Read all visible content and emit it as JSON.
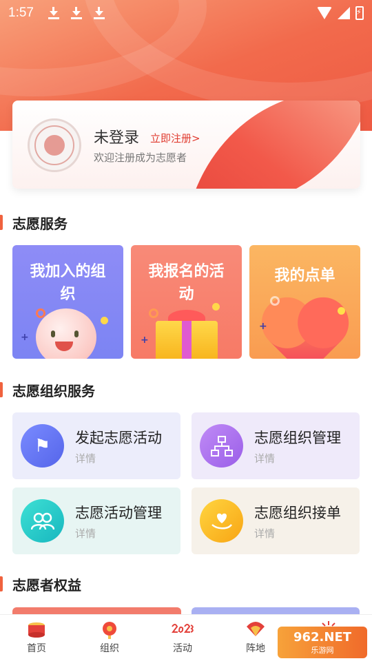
{
  "status_bar": {
    "time": "1:57"
  },
  "profile": {
    "title": "未登录",
    "register_link": "立即注册>",
    "subtitle": "欢迎注册成为志愿者"
  },
  "section_volunteer_service": {
    "title": "志愿服务",
    "tiles": [
      {
        "label": "我加入的组织",
        "color": "#8e8cf6",
        "icon": "smiley-face-icon"
      },
      {
        "label": "我报名的活动",
        "color": "#f88a78",
        "icon": "gift-box-icon"
      },
      {
        "label": "我的点单",
        "color": "#fbb662",
        "icon": "heart-icon"
      }
    ]
  },
  "section_org_service": {
    "title": "志愿组织服务",
    "cards": [
      {
        "title": "发起志愿活动",
        "subtitle": "详情",
        "icon": "flag-icon",
        "color": "#5565ea"
      },
      {
        "title": "志愿组织管理",
        "subtitle": "详情",
        "icon": "org-chart-icon",
        "color": "#9a5ee8"
      },
      {
        "title": "志愿活动管理",
        "subtitle": "详情",
        "icon": "people-icon",
        "color": "#17b7bf"
      },
      {
        "title": "志愿组织接单",
        "subtitle": "详情",
        "icon": "hand-heart-icon",
        "color": "#f8a514"
      }
    ]
  },
  "section_benefits": {
    "title": "志愿者权益"
  },
  "bottom_nav": [
    {
      "label": "首页",
      "icon": "drum-icon"
    },
    {
      "label": "组织",
      "icon": "lantern-icon"
    },
    {
      "label": "活动",
      "icon": "calendar-2023-icon"
    },
    {
      "label": "阵地",
      "icon": "fan-icon"
    }
  ],
  "watermark": {
    "text": "962.NET",
    "sub": "乐游网"
  },
  "colors": {
    "accent": "#f0623e",
    "header": "#f26a4c"
  }
}
